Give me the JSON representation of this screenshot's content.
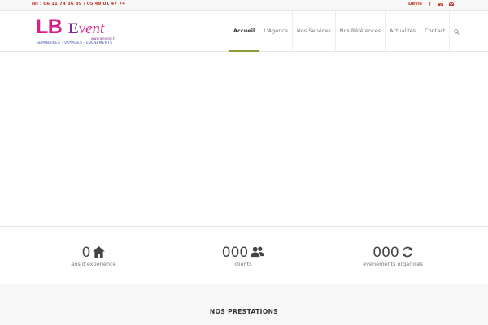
{
  "topbar": {
    "phone": "Tel : 06 11 74 36 89 / 05 49 01 47 74",
    "devis": "Devis",
    "social": [
      "facebook-icon",
      "youtube-icon",
      "mail-icon"
    ],
    "social_fb_glyph": "f"
  },
  "logo": {
    "lb": "LB",
    "event_e": "E",
    "event_rest": "vent",
    "url": "www.lbevent.fr",
    "tagline": "SÉMINAIRES - VOYAGES - ÉVÉNEMENTS"
  },
  "nav": {
    "items": [
      {
        "label": "Accueil",
        "active": true
      },
      {
        "label": "L'Agence",
        "active": false
      },
      {
        "label": "Nos Services",
        "active": false
      },
      {
        "label": "Nos Références",
        "active": false
      },
      {
        "label": "Actualités",
        "active": false
      },
      {
        "label": "Contact",
        "active": false
      }
    ],
    "search_icon": "search-icon"
  },
  "stats": [
    {
      "value": "0",
      "label": "ans d'expérience",
      "icon": "home-icon"
    },
    {
      "value": "000",
      "label": "clients",
      "icon": "users-icon"
    },
    {
      "value": "000",
      "label": "évènements organisés",
      "icon": "refresh-icon"
    }
  ],
  "prestations": {
    "title": "NOS PRESTATIONS"
  },
  "colors": {
    "accent_red": "#c0392b",
    "brand_pink": "#d61f8b",
    "brand_purple": "#7b2d8e",
    "nav_active_underline": "#8c9b3a"
  }
}
